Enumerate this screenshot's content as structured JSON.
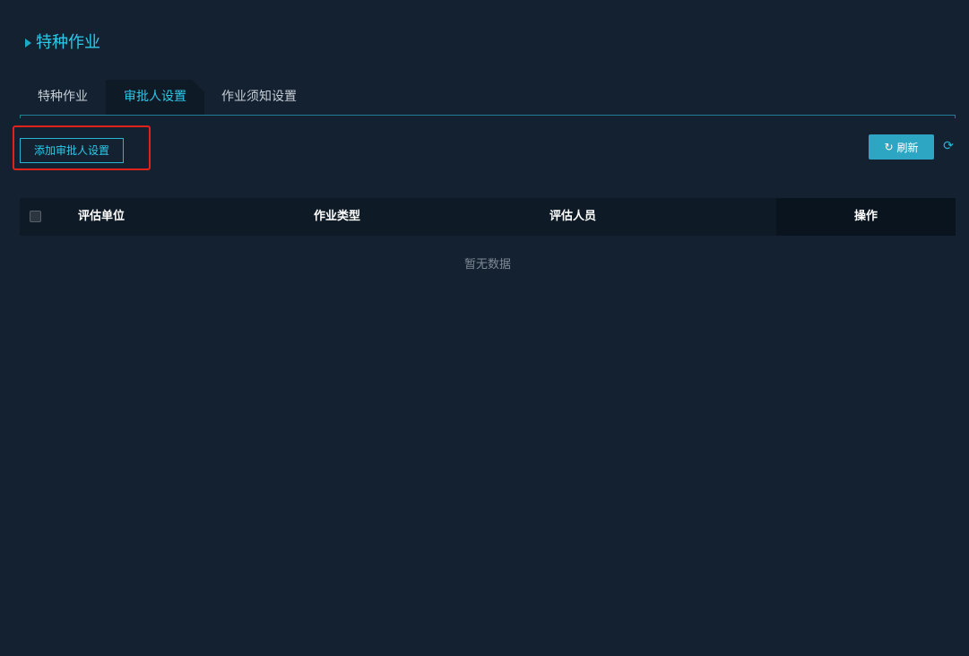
{
  "page": {
    "title": "特种作业",
    "title_icon": "triangle-right-icon"
  },
  "tabs": [
    {
      "label": "特种作业",
      "active": false
    },
    {
      "label": "审批人设置",
      "active": true
    },
    {
      "label": "作业须知设置",
      "active": false
    }
  ],
  "toolbar": {
    "add_label": "添加审批人设置",
    "refresh_label": "刷新",
    "refresh_icon": "refresh-icon",
    "sync_icon": "sync-icon"
  },
  "table": {
    "columns": [
      "评估单位",
      "作业类型",
      "评估人员",
      "操作"
    ],
    "rows": [],
    "empty_text": "暂无数据"
  },
  "colors": {
    "background": "#142131",
    "accent": "#2cc9e8",
    "button_fill": "#2ca6c2",
    "highlight": "#e0221a",
    "header_bg": "#0e1a26"
  }
}
